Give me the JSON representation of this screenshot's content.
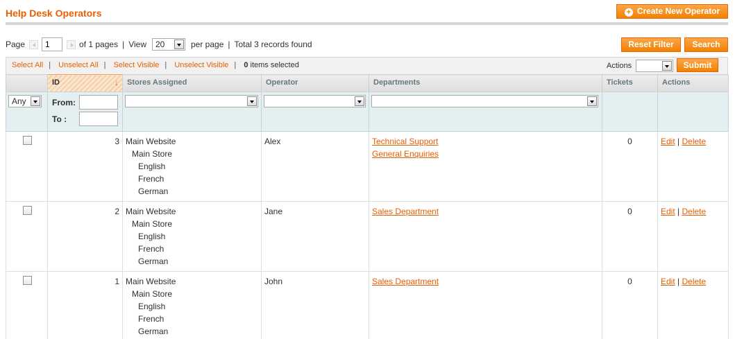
{
  "header": {
    "title": "Help Desk Operators",
    "create_button": "Create New Operator"
  },
  "pager": {
    "page_label": "Page",
    "page_value": "1",
    "of_pages": "of 1 pages",
    "view_label": "View",
    "per_page_value": "20",
    "per_page_label": "per page",
    "total": "Total 3 records found",
    "reset_button": "Reset Filter",
    "search_button": "Search"
  },
  "massaction": {
    "select_all": "Select All",
    "unselect_all": "Unselect All",
    "select_visible": "Select Visible",
    "unselect_visible": "Unselect Visible",
    "selected_count": "0",
    "selected_suffix": "items selected",
    "actions_label": "Actions",
    "actions_value": "",
    "submit_button": "Submit"
  },
  "grid": {
    "columns": [
      "",
      "ID",
      "Stores Assigned",
      "Operator",
      "Departments",
      "Tickets",
      "Actions"
    ],
    "filter": {
      "any_value": "Any",
      "from_label": "From:",
      "to_label": "To :"
    },
    "rows": [
      {
        "id": "3",
        "stores": [
          "Main Website",
          "Main Store",
          "English",
          "French",
          "German"
        ],
        "operator": "Alex",
        "departments": [
          "Technical Support",
          "General Enquiries"
        ],
        "tickets": "0",
        "edit": "Edit",
        "sep": "|",
        "delete": "Delete"
      },
      {
        "id": "2",
        "stores": [
          "Main Website",
          "Main Store",
          "English",
          "French",
          "German"
        ],
        "operator": "Jane",
        "departments": [
          "Sales Department"
        ],
        "tickets": "0",
        "edit": "Edit",
        "sep": "|",
        "delete": "Delete"
      },
      {
        "id": "1",
        "stores": [
          "Main Website",
          "Main Store",
          "English",
          "French",
          "German"
        ],
        "operator": "John",
        "departments": [
          "Sales Department"
        ],
        "tickets": "0",
        "edit": "Edit",
        "sep": "|",
        "delete": "Delete"
      }
    ]
  },
  "colors": {
    "accent": "#eb5e00",
    "button": "#f18200",
    "filter_bg": "#e3eff1"
  }
}
